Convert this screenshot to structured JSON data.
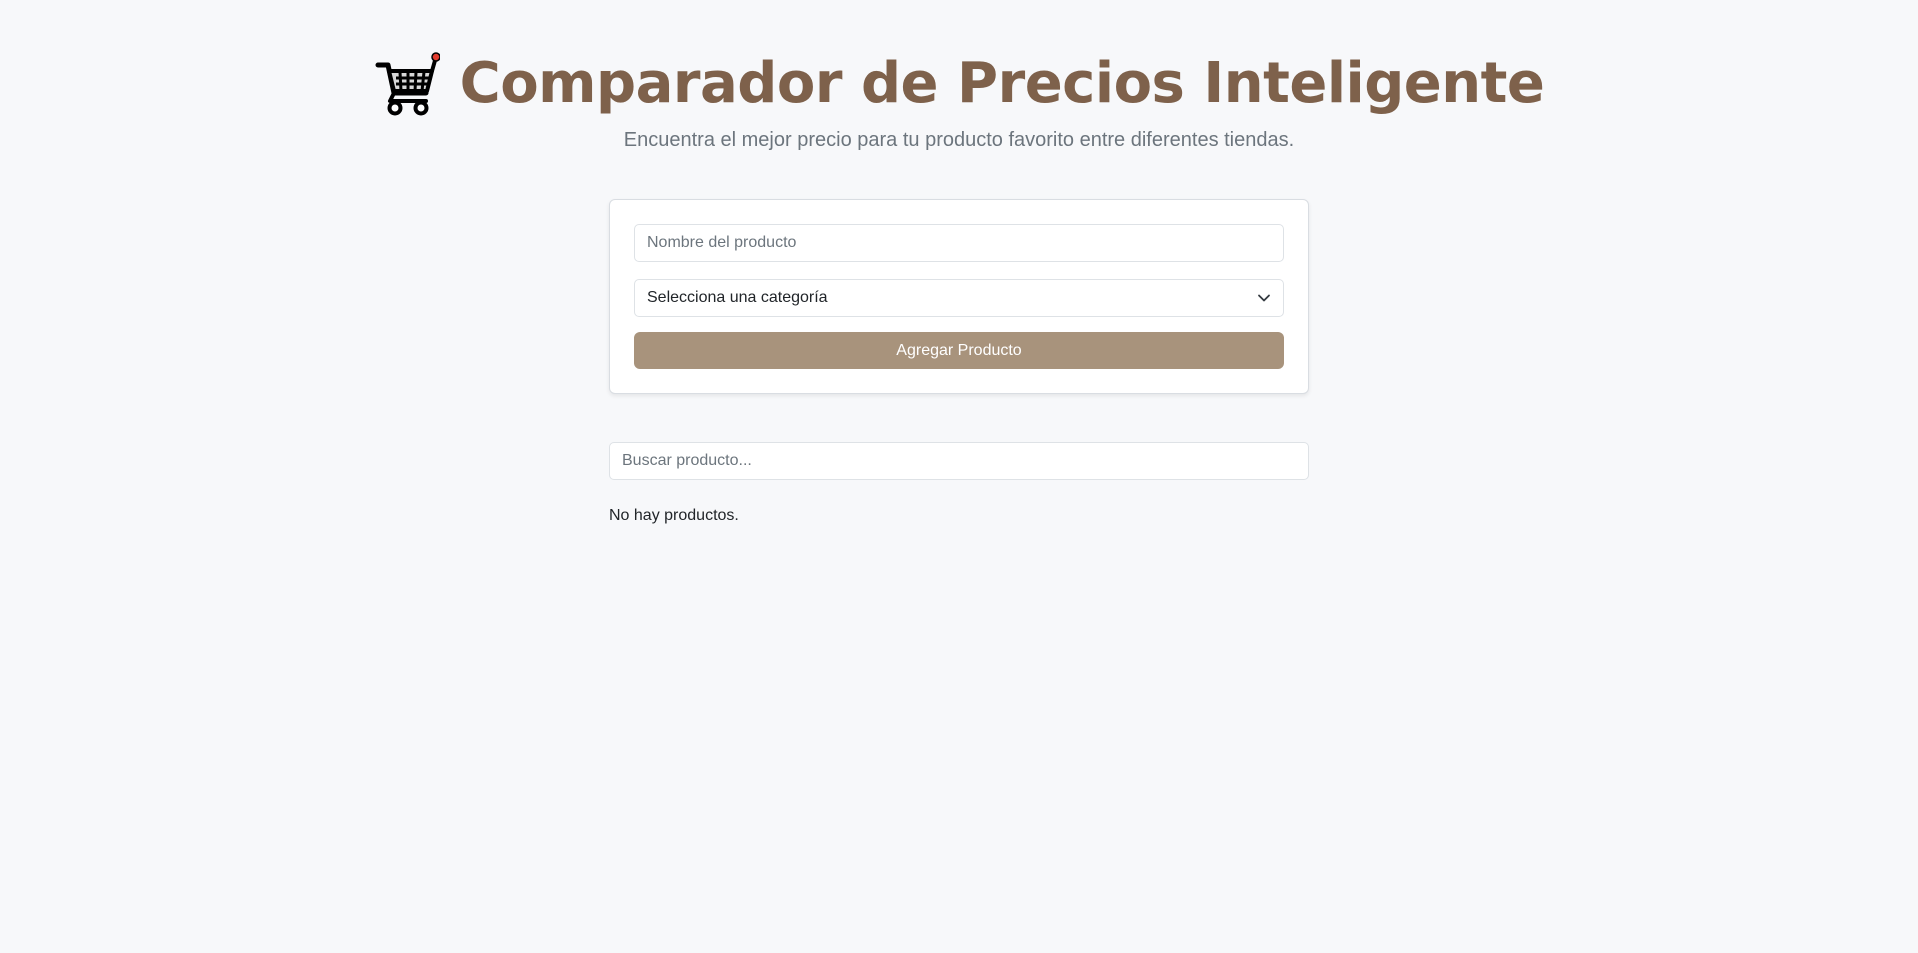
{
  "header": {
    "title": "Comparador de Precios Inteligente",
    "subtitle": "Encuentra el mejor precio para tu producto favorito entre diferentes tiendas.",
    "icon": "shopping-cart-icon",
    "title_color": "#7e614b"
  },
  "form": {
    "name_placeholder": "Nombre del producto",
    "name_value": "",
    "category_selected": "Selecciona una categoría",
    "submit_label": "Agregar Producto",
    "button_color": "#a8937c"
  },
  "search": {
    "placeholder": "Buscar producto...",
    "value": ""
  },
  "list": {
    "empty_message": "No hay productos."
  }
}
